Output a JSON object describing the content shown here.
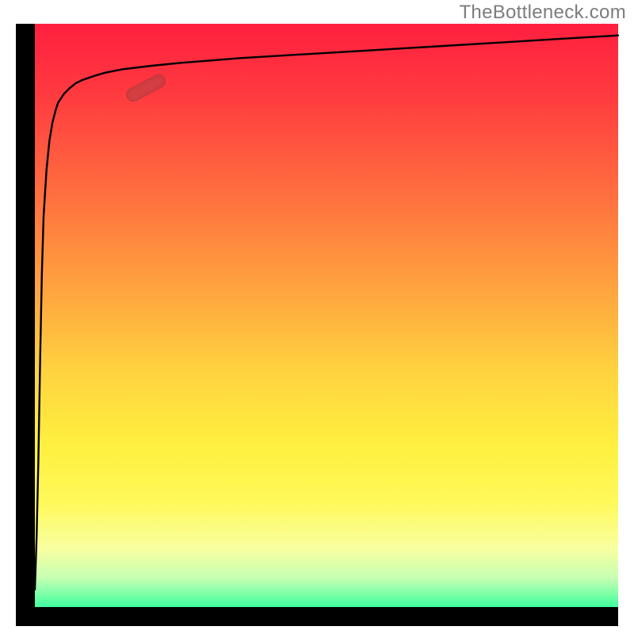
{
  "attribution": "TheBottleneck.com",
  "chart_data": {
    "type": "line",
    "title": "",
    "xlabel": "",
    "ylabel": "",
    "xlim": [
      0,
      100
    ],
    "ylim": [
      0,
      100
    ],
    "note": "Axes unlabeled in source; x and y normalized 0–100. Values estimated from pixels.",
    "series": [
      {
        "name": "curve",
        "x": [
          0.0,
          0.3,
          0.6,
          0.9,
          1.2,
          1.5,
          2.0,
          2.5,
          3.0,
          3.5,
          4.0,
          5.0,
          6.0,
          7.0,
          8.0,
          10.0,
          12.0,
          15.0,
          20.0,
          25.0,
          30.0,
          35.0,
          40.0,
          50.0,
          60.0,
          70.0,
          80.0,
          90.0,
          100.0
        ],
        "y": [
          3.0,
          12.0,
          25.0,
          42.0,
          57.0,
          67.0,
          75.0,
          80.0,
          83.0,
          85.0,
          86.5,
          88.0,
          89.0,
          89.8,
          90.3,
          91.0,
          91.6,
          92.2,
          92.8,
          93.3,
          93.7,
          94.1,
          94.4,
          95.0,
          95.6,
          96.2,
          96.8,
          97.4,
          98.0
        ]
      }
    ],
    "marker": {
      "center_x": 19.0,
      "center_y": 89.0,
      "rotation_deg": -28
    },
    "gradient_stops": [
      {
        "pos": 0.0,
        "color": "#ff1f3f"
      },
      {
        "pos": 0.28,
        "color": "#ff6b3f"
      },
      {
        "pos": 0.6,
        "color": "#ffd43f"
      },
      {
        "pos": 0.82,
        "color": "#fff95a"
      },
      {
        "pos": 1.0,
        "color": "#40ff9e"
      }
    ]
  }
}
